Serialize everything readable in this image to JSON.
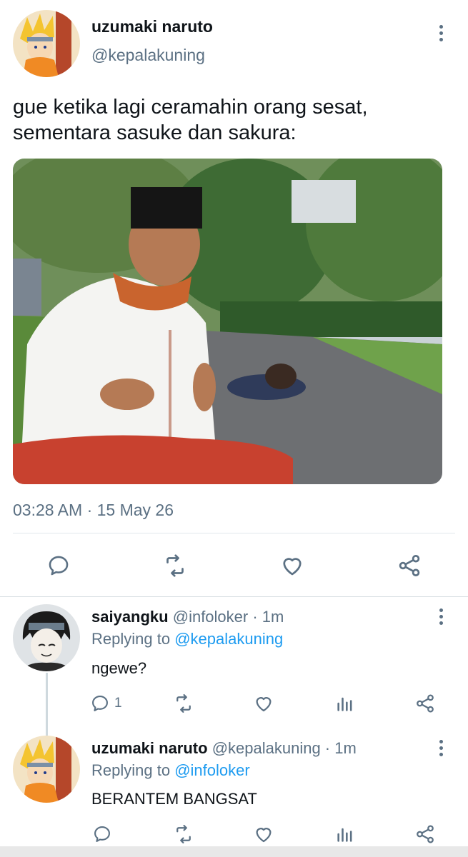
{
  "main_tweet": {
    "name": "uzumaki naruto",
    "handle": "@kepalakuning",
    "text_line1": "gue ketika lagi ceramahin orang sesat,",
    "text_line2": "sementara sasuke dan sakura:",
    "timestamp": "03:28 AM · 15 May 26",
    "actions": [
      "reply-icon",
      "retweet-icon",
      "like-icon",
      "share-icon"
    ]
  },
  "replies": [
    {
      "name": "saiyangku",
      "handle_time": "@infoloker · 1m",
      "replying_prefix": "Replying to ",
      "replying_to": "@kepalakuning",
      "text": "ngewe?",
      "reply_count": "1",
      "actions": [
        "reply-icon",
        "retweet-icon",
        "like-icon",
        "analytics-icon",
        "share-icon"
      ]
    },
    {
      "name": "uzumaki naruto",
      "handle_time": "@kepalakuning · 1m",
      "replying_prefix": "Replying to ",
      "replying_to": "@infoloker",
      "text": "BERANTEM BANGSAT",
      "reply_count": "",
      "actions": [
        "reply-icon",
        "retweet-icon",
        "like-icon",
        "analytics-icon",
        "share-icon"
      ]
    }
  ],
  "colors": {
    "text": "#0f1419",
    "secondary": "#5b7083",
    "link": "#1d9bf0",
    "divider": "#e1e8ed"
  }
}
